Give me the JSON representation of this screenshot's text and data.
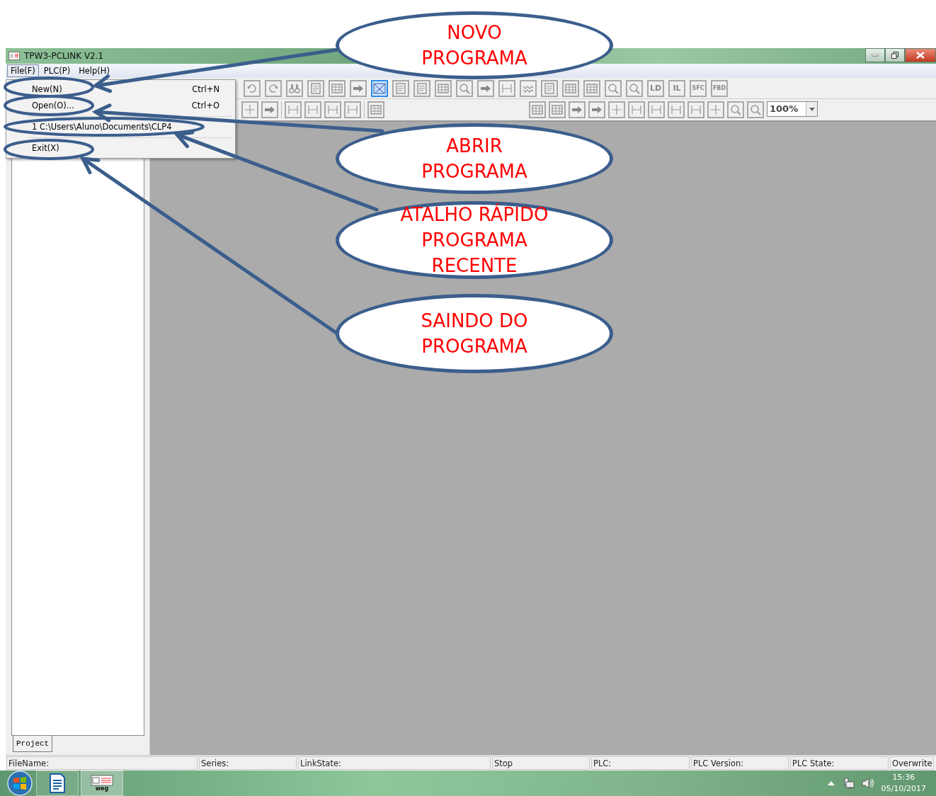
{
  "window": {
    "title": "TPW3-PCLINK V2.1"
  },
  "menu_bar": [
    {
      "label": "File(F)",
      "selected": true
    },
    {
      "label": "PLC(P)",
      "selected": false
    },
    {
      "label": "Help(H)",
      "selected": false
    }
  ],
  "file_menu": [
    {
      "kind": "item",
      "label": "New(N)",
      "shortcut": "Ctrl+N"
    },
    {
      "kind": "item",
      "label": "Open(O)...",
      "shortcut": "Ctrl+O"
    },
    {
      "kind": "separator"
    },
    {
      "kind": "item",
      "label": "1 C:\\Users\\Aluno\\Documents\\CLP4"
    },
    {
      "kind": "separator"
    },
    {
      "kind": "item",
      "label": "Exit(X)"
    }
  ],
  "toolbar_1": [
    {
      "kind": "icon",
      "pressed": false
    },
    {
      "kind": "icon",
      "pressed": false
    },
    {
      "kind": "icon",
      "pressed": false
    },
    {
      "kind": "icon",
      "pressed": false
    },
    {
      "kind": "icon",
      "pressed": false
    },
    {
      "kind": "icon",
      "pressed": false
    },
    {
      "kind": "icon",
      "pressed": true
    },
    {
      "kind": "icon",
      "pressed": false
    },
    {
      "kind": "icon",
      "pressed": false
    },
    {
      "kind": "icon",
      "pressed": false
    },
    {
      "kind": "icon",
      "pressed": false
    },
    {
      "kind": "icon",
      "pressed": false
    },
    {
      "kind": "icon",
      "pressed": false
    },
    {
      "kind": "icon",
      "pressed": false
    },
    {
      "kind": "icon",
      "pressed": false
    },
    {
      "kind": "icon",
      "pressed": false
    },
    {
      "kind": "icon",
      "pressed": false
    },
    {
      "kind": "icon",
      "pressed": false
    },
    {
      "kind": "icon",
      "pressed": false
    },
    {
      "kind": "text",
      "label": "LD",
      "pressed": false
    },
    {
      "kind": "text",
      "label": "IL",
      "pressed": false
    },
    {
      "kind": "text",
      "label": "SFC",
      "pressed": false
    },
    {
      "kind": "text",
      "label": "FBD",
      "pressed": false
    }
  ],
  "toolbar_2_left": [
    {
      "kind": "icon",
      "pressed": false
    },
    {
      "kind": "icon",
      "pressed": false
    },
    {
      "kind": "separator"
    },
    {
      "kind": "icon",
      "pressed": false
    },
    {
      "kind": "icon",
      "pressed": false
    },
    {
      "kind": "icon",
      "pressed": false
    },
    {
      "kind": "icon",
      "pressed": false
    },
    {
      "kind": "separator"
    },
    {
      "kind": "icon",
      "pressed": false
    }
  ],
  "toolbar_2_right": [
    {
      "kind": "icon",
      "pressed": false
    },
    {
      "kind": "icon",
      "pressed": false
    },
    {
      "kind": "icon",
      "pressed": false
    },
    {
      "kind": "icon",
      "pressed": false
    },
    {
      "kind": "icon",
      "pressed": false
    },
    {
      "kind": "icon",
      "pressed": false
    },
    {
      "kind": "icon",
      "pressed": false
    },
    {
      "kind": "icon",
      "pressed": false
    },
    {
      "kind": "icon",
      "pressed": false
    },
    {
      "kind": "icon",
      "pressed": false
    },
    {
      "kind": "icon",
      "pressed": false
    },
    {
      "kind": "icon",
      "pressed": false
    }
  ],
  "zoom": {
    "value": "100%"
  },
  "project_pane": {
    "tab": "Project"
  },
  "status_bar": [
    "FileName:",
    "Series:",
    "LinkState:",
    "Stop",
    "PLC:",
    "PLC Version:",
    "PLC State:",
    "Overwrite"
  ],
  "taskbar": {
    "app_label": "weg",
    "time": "15:36",
    "date": "05/10/2017"
  },
  "callouts": [
    {
      "text": "NOVO\nPROGRAMA"
    },
    {
      "text": "ABRIR\nPROGRAMA"
    },
    {
      "text": "ATALHO RÁPIDO\nPROGRAMA\nRECENTE"
    },
    {
      "text": "SAINDO DO\nPROGRAMA"
    }
  ]
}
